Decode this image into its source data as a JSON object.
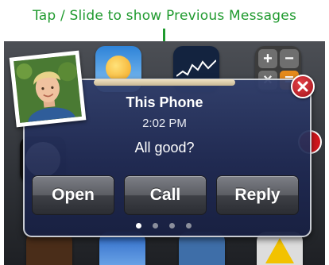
{
  "annotation": {
    "text": "Tap / Slide to show Previous Messages",
    "color": "#1f9a2e"
  },
  "background_icons": [
    "weather-icon",
    "stocks-icon",
    "calculator-icon",
    "clock-icon",
    "cydia-icon",
    "maps-icon",
    "notes-icon",
    "warning-icon"
  ],
  "notification": {
    "sender": "This Phone",
    "time": "2:02 PM",
    "message": "All good?",
    "buttons": {
      "open": "Open",
      "call": "Call",
      "reply": "Reply"
    },
    "pages": {
      "count": 4,
      "current": 1
    },
    "avatar_icon": "contact-photo",
    "close_icon": "close-icon",
    "colors": {
      "panel": "#2a3670",
      "close": "#c0171f",
      "handle": "#e2d3b0"
    }
  }
}
